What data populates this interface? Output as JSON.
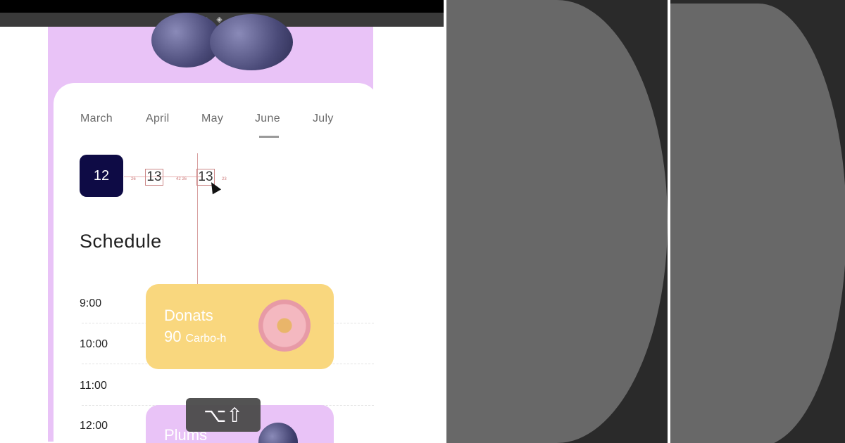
{
  "toolbar": {
    "icons": [
      "frame-icon",
      "component-icon",
      "contrast-icon"
    ],
    "glyphs": [
      "⌗",
      "◈",
      "◐"
    ]
  },
  "calendar": {
    "months": [
      "March",
      "April",
      "May",
      "June",
      "July"
    ],
    "active_month": "June",
    "selected_day": "12",
    "days": [
      "13",
      "13"
    ]
  },
  "schedule": {
    "title": "Schedule",
    "times": [
      "9:00",
      "10:00",
      "11:00",
      "12:00"
    ],
    "events": [
      {
        "title": "Donats",
        "amount": "90",
        "unit": "Carbo-h"
      },
      {
        "title": "Plums"
      }
    ]
  },
  "measure_labels": [
    "26",
    "42 26",
    "23"
  ],
  "shortcut_hud": {
    "keys": "⌥⇧"
  },
  "colors": {
    "canvas_bg": "#ffffff",
    "pink_header": "#e9c3f7",
    "selected_day_bg": "#0e0b45",
    "donut_card": "#f9d77e",
    "panel_bg": "#2a2a2a",
    "shape_fill": "#686868"
  }
}
